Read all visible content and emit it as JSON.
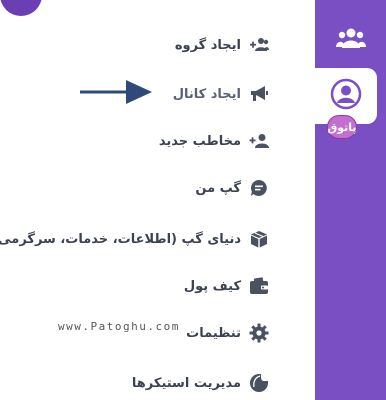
{
  "menu": {
    "items": [
      {
        "label": "ایجاد گروه",
        "icon": "add-group-icon"
      },
      {
        "label": "ایجاد کانال",
        "icon": "megaphone-icon"
      },
      {
        "label": "مخاطب جدید",
        "icon": "add-contact-icon"
      },
      {
        "label": "گپ من",
        "icon": "chat-bubble-icon"
      },
      {
        "label": "دنیای گپ (اطلاعات، خدمات، سرگرمی)",
        "icon": "gift-box-icon"
      },
      {
        "label": "کیف پول",
        "icon": "wallet-icon"
      },
      {
        "label": "تنظیمات",
        "icon": "gear-icon"
      },
      {
        "label": "مدیریت استیکرها",
        "icon": "sticker-icon"
      }
    ]
  },
  "sidebar": {
    "buttons": [
      {
        "icon": "contacts-group-icon"
      },
      {
        "icon": "profile-icon"
      }
    ]
  },
  "watermark": {
    "text": "www.Patoghu.com",
    "logo_text": "پاتوق"
  },
  "colors": {
    "sidebar": "#7a4fc4",
    "menu_text": "#3b4351",
    "icon": "#4a5261",
    "arrow": "#2f4a78"
  }
}
